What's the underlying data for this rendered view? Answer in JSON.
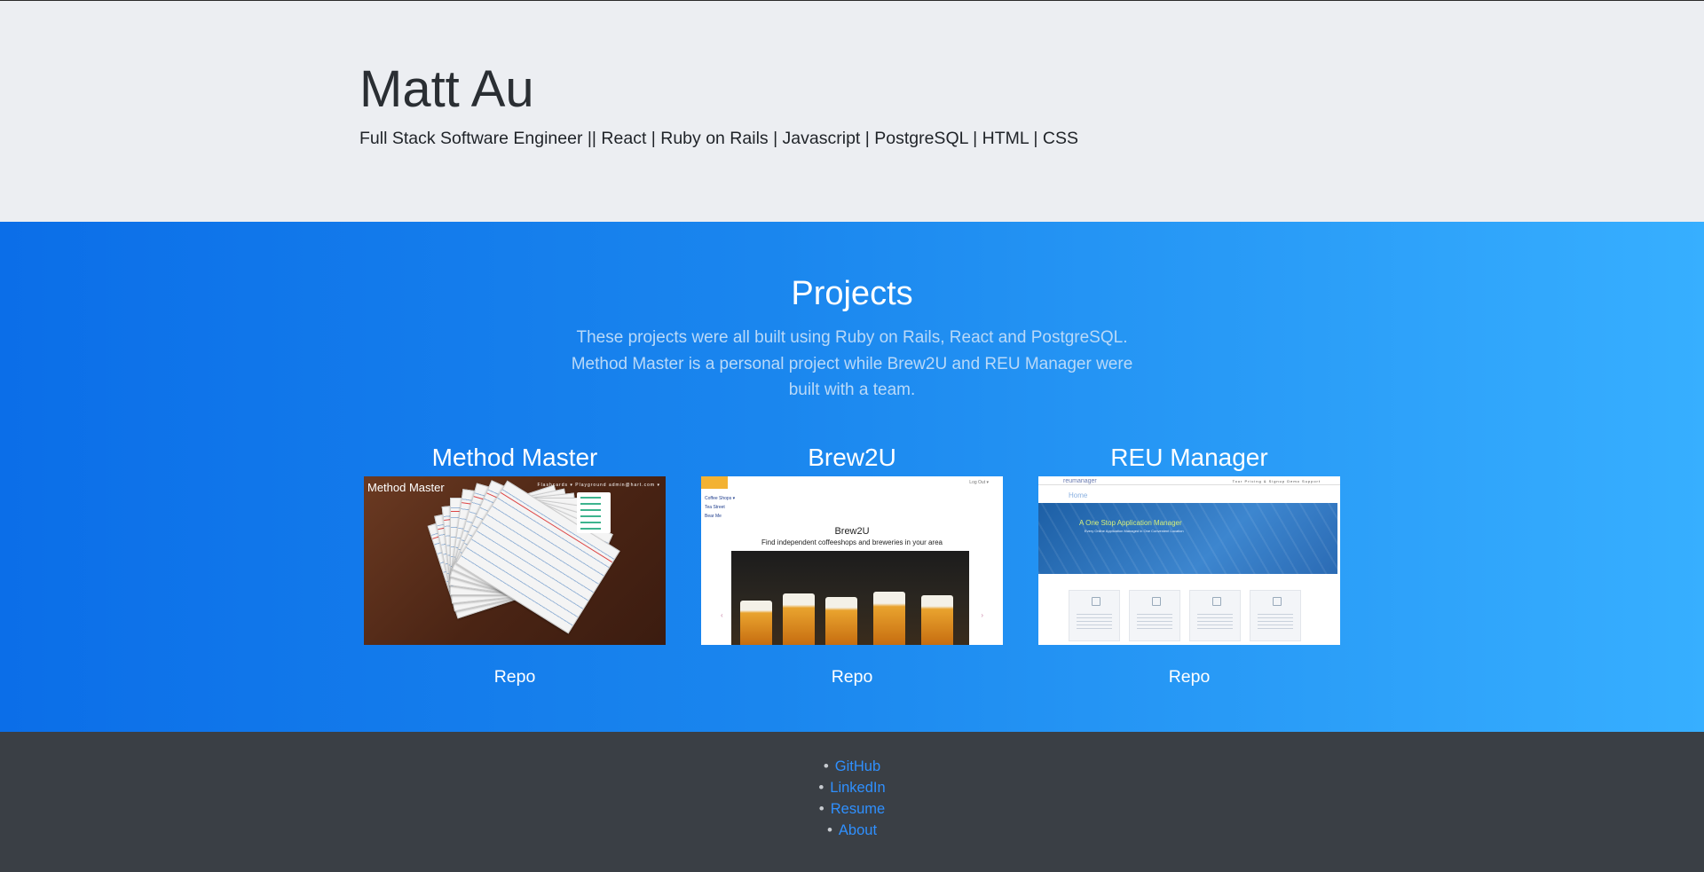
{
  "header": {
    "name": "Matt Au",
    "tagline": "Full Stack Software Engineer || React | Ruby on Rails | Javascript | PostgreSQL | HTML | CSS"
  },
  "projects": {
    "title": "Projects",
    "description": "These projects were all built using Ruby on Rails, React and PostgreSQL. Method Master is a personal project while Brew2U and REU Manager were built with a team.",
    "items": [
      {
        "title": "Method Master",
        "repo_label": "Repo",
        "screenshot": {
          "app_title": "Method Master",
          "nav": "Flashcards ▾   Playground   admin@hart.com ▾"
        }
      },
      {
        "title": "Brew2U",
        "repo_label": "Repo",
        "screenshot": {
          "logout": "Log Out ▾",
          "sidebar": [
            "Coffee Shops ▾",
            "Tea Street",
            "Bear Me"
          ],
          "heading": "Brew2U",
          "subheading": "Find independent coffeeshops and breweries in your area"
        }
      },
      {
        "title": "REU Manager",
        "repo_label": "Repo",
        "screenshot": {
          "brand": "reumanager",
          "links": "Tour   Pricing & Signup   Demo   Support",
          "home": "Home",
          "hero": "A One Stop Application Manager",
          "hero_sub": "Every Online Application Managed in One Convenient Location"
        }
      }
    ]
  },
  "footer": {
    "links": [
      "GitHub",
      "LinkedIn",
      "Resume",
      "About"
    ]
  },
  "colors": {
    "jumbotron_bg": "#eceef2",
    "gradient_start": "#0b6ee8",
    "gradient_end": "#37afff",
    "footer_bg": "#3a3f45",
    "footer_link": "#2f90ff"
  }
}
